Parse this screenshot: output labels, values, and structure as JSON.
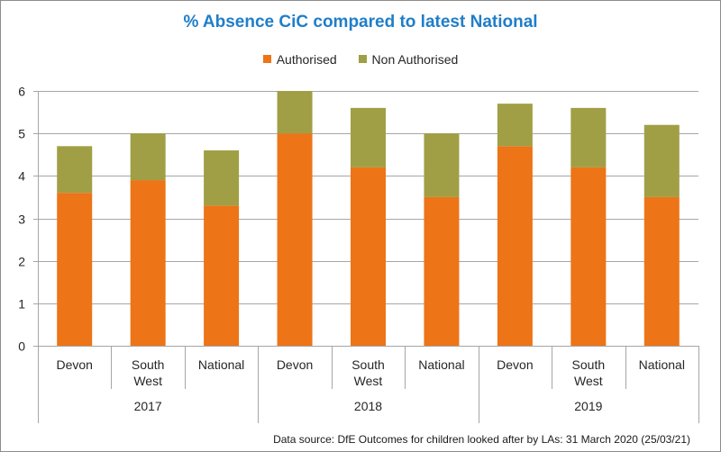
{
  "chart_data": {
    "type": "bar",
    "stacked": true,
    "title": "% Absence CiC compared to latest National",
    "xlabel": "",
    "ylabel": "",
    "ylim": [
      0,
      6
    ],
    "yticks": [
      0,
      1,
      2,
      3,
      4,
      5,
      6
    ],
    "grid": true,
    "legend_position": "top",
    "groups": [
      {
        "label": "2017",
        "categories": [
          "Devon",
          "South West",
          "National"
        ]
      },
      {
        "label": "2018",
        "categories": [
          "Devon",
          "South West",
          "National"
        ]
      },
      {
        "label": "2019",
        "categories": [
          "Devon",
          "South West",
          "National"
        ]
      }
    ],
    "categories": [
      "Devon",
      "South West",
      "National",
      "Devon",
      "South West",
      "National",
      "Devon",
      "South West",
      "National"
    ],
    "category_label_lines": [
      [
        "Devon"
      ],
      [
        "South",
        "West"
      ],
      [
        "National"
      ],
      [
        "Devon"
      ],
      [
        "South",
        "West"
      ],
      [
        "National"
      ],
      [
        "Devon"
      ],
      [
        "South",
        "West"
      ],
      [
        "National"
      ]
    ],
    "series": [
      {
        "name": "Authorised",
        "color": "#ed7417",
        "values": [
          3.6,
          3.9,
          3.3,
          5.0,
          4.2,
          3.5,
          4.7,
          4.2,
          3.5
        ]
      },
      {
        "name": "Non Authorised",
        "color": "#a09f45",
        "values": [
          1.1,
          1.1,
          1.3,
          1.0,
          1.4,
          1.5,
          1.0,
          1.4,
          1.7
        ]
      }
    ],
    "source_note": "Data source: DfE Outcomes for children looked after by LAs: 31 March 2020 (25/03/21)"
  }
}
